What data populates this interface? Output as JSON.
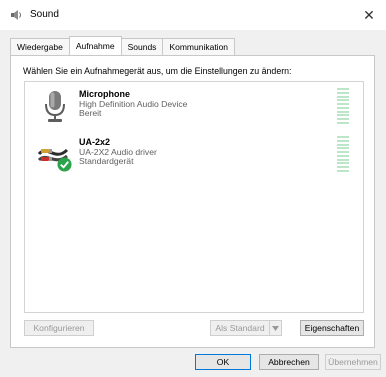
{
  "window": {
    "title": "Sound",
    "close_symbol": "✕",
    "icons": {
      "app": "speaker-icon",
      "close": "close-icon"
    }
  },
  "tabs": [
    {
      "label": "Wiedergabe",
      "active": false
    },
    {
      "label": "Aufnahme",
      "active": true
    },
    {
      "label": "Sounds",
      "active": false
    },
    {
      "label": "Kommunikation",
      "active": false
    }
  ],
  "panel": {
    "instruction": "Wählen Sie ein Aufnahmegerät aus, um die Einstellungen zu ändern:",
    "devices": [
      {
        "name": "Microphone",
        "description": "High Definition Audio Device",
        "status": "Bereit",
        "icon": "microphone-icon",
        "default": false
      },
      {
        "name": "UA-2x2",
        "description": "UA-2X2 Audio driver",
        "status": "Standardgerät",
        "icon": "audio-interface-icon",
        "default": true,
        "default_badge_icon": "checkmark-icon"
      }
    ],
    "level_meter_icon": "level-meter-icon",
    "buttons": {
      "configure": "Konfigurieren",
      "set_default": "Als Standard",
      "properties": "Eigenschaften"
    }
  },
  "footer": {
    "ok": "OK",
    "cancel": "Abbrechen",
    "apply": "Übernehmen"
  },
  "colors": {
    "accent": "#0078d7",
    "meter": "#bde5c8",
    "disabled_text": "#9a9a9a",
    "check_green": "#2aa34a"
  }
}
